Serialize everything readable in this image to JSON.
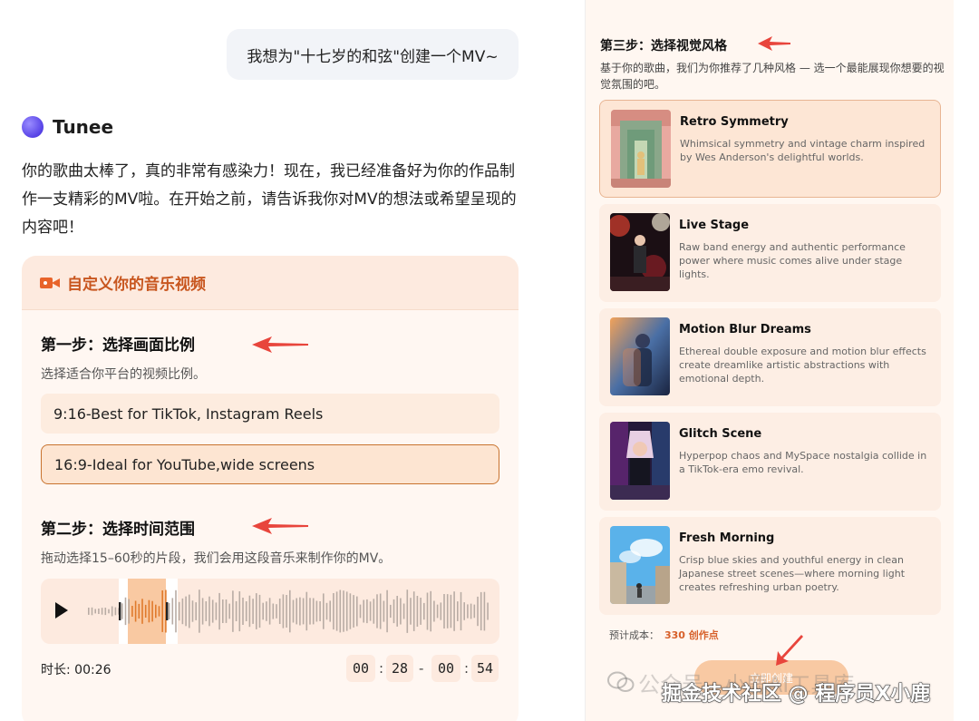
{
  "chat": {
    "user_message": "我想为\"十七岁的和弦\"创建一个MV~",
    "bot_name": "Tunee",
    "bot_message": "你的歌曲太棒了，真的非常有感染力！现在，我已经准备好为你的作品制作一支精彩的MV啦。在开始之前，请告诉我你对MV的想法或希望呈现的内容吧！"
  },
  "card": {
    "title": "自定义你的音乐视频",
    "step1": {
      "title": "第一步：选择画面比例",
      "desc": "选择适合你平台的视频比例。",
      "options": [
        {
          "label": "9:16-Best for TikTok, Instagram Reels",
          "selected": false
        },
        {
          "label": "16:9-Ideal for YouTube,wide screens",
          "selected": true
        }
      ]
    },
    "step2": {
      "title": "第二步：选择时间范围",
      "desc": "拖动选择15–60秒的片段，我们会用这段音乐来制作你的MV。",
      "duration_label": "时长: 00:26",
      "start": {
        "min": "00",
        "sec": "28"
      },
      "end": {
        "min": "00",
        "sec": "54"
      }
    }
  },
  "right": {
    "step3_title": "第三步：选择视觉风格",
    "step3_desc": "基于你的歌曲，我们为你推荐了几种风格 — 选一个最能展现你想要的视觉氛围的吧。",
    "styles": [
      {
        "title": "Retro Symmetry",
        "desc": "Whimsical symmetry and vintage charm inspired by Wes Anderson's delightful worlds.",
        "selected": true,
        "icon": "retro-symmetry-thumbnail"
      },
      {
        "title": "Live Stage",
        "desc": "Raw band energy and authentic performance power where music comes alive under stage lights.",
        "selected": false,
        "icon": "live-stage-thumbnail"
      },
      {
        "title": "Motion Blur Dreams",
        "desc": "Ethereal double exposure and motion blur effects create dreamlike artistic abstractions with emotional depth.",
        "selected": false,
        "icon": "motion-blur-thumbnail"
      },
      {
        "title": "Glitch Scene",
        "desc": "Hyperpop chaos and MySpace nostalgia collide in a TikTok-era emo revival.",
        "selected": false,
        "icon": "glitch-scene-thumbnail"
      },
      {
        "title": "Fresh Morning",
        "desc": "Crisp blue skies and youthful energy in clean Japanese street scenes—where morning light creates refreshing urban poetry.",
        "selected": false,
        "icon": "fresh-morning-thumbnail"
      }
    ],
    "cost_label": "预计成本：",
    "cost_value": "330 创作点",
    "create_label": "立即创建"
  },
  "watermark": {
    "line1": "公众号 · 小鹿AI工具库",
    "line2": "掘金技术社区 @ 程序员X小鹿"
  },
  "colors": {
    "accent": "#e8632a",
    "annotation_arrow": "#e8453c",
    "card_bg": "#fff7f2"
  }
}
